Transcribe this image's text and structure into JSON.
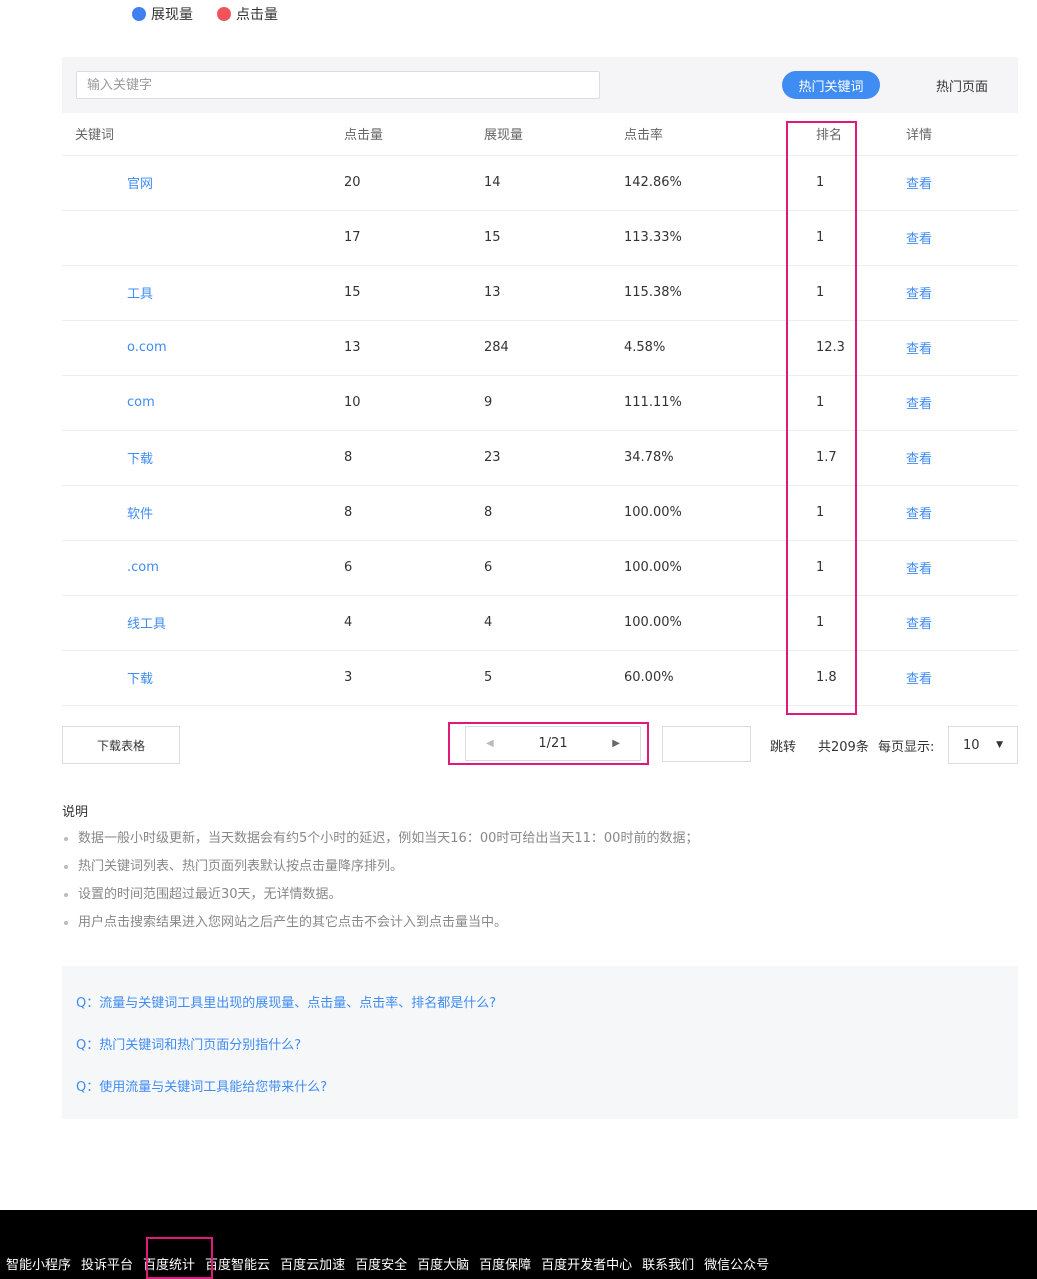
{
  "legend": {
    "items": [
      {
        "label": "展现量",
        "color": "#3f7ff0"
      },
      {
        "label": "点击量",
        "color": "#f0545a"
      }
    ]
  },
  "toolbar": {
    "search_placeholder": "输入关键字",
    "tab_active": "热门关键词",
    "tab_other": "热门页面"
  },
  "table": {
    "headers": [
      "关键词",
      "点击量",
      "展现量",
      "点击率",
      "排名",
      "详情"
    ],
    "rows": [
      {
        "keyword": "官网",
        "clicks": "20",
        "impressions": "14",
        "ctr": "142.86%",
        "rank": "1",
        "detail": "查看"
      },
      {
        "keyword": "",
        "clicks": "17",
        "impressions": "15",
        "ctr": "113.33%",
        "rank": "1",
        "detail": "查看"
      },
      {
        "keyword": "工具",
        "clicks": "15",
        "impressions": "13",
        "ctr": "115.38%",
        "rank": "1",
        "detail": "查看"
      },
      {
        "keyword": "o.com",
        "clicks": "13",
        "impressions": "284",
        "ctr": "4.58%",
        "rank": "12.3",
        "detail": "查看"
      },
      {
        "keyword": "com",
        "clicks": "10",
        "impressions": "9",
        "ctr": "111.11%",
        "rank": "1",
        "detail": "查看"
      },
      {
        "keyword": "下载",
        "clicks": "8",
        "impressions": "23",
        "ctr": "34.78%",
        "rank": "1.7",
        "detail": "查看"
      },
      {
        "keyword": "软件",
        "clicks": "8",
        "impressions": "8",
        "ctr": "100.00%",
        "rank": "1",
        "detail": "查看"
      },
      {
        "keyword": ".com",
        "clicks": "6",
        "impressions": "6",
        "ctr": "100.00%",
        "rank": "1",
        "detail": "查看"
      },
      {
        "keyword": "线工具",
        "clicks": "4",
        "impressions": "4",
        "ctr": "100.00%",
        "rank": "1",
        "detail": "查看"
      },
      {
        "keyword": "下载",
        "clicks": "3",
        "impressions": "5",
        "ctr": "60.00%",
        "rank": "1.8",
        "detail": "查看"
      }
    ]
  },
  "pagination": {
    "download_label": "下载表格",
    "page": "1/21",
    "jump_label": "跳转",
    "total": "共209条",
    "per_page_label": "每页显示:",
    "per_page_value": "10"
  },
  "notes": {
    "title": "说明",
    "items": [
      "数据一般小时级更新，当天数据会有约5个小时的延迟，例如当天16：00时可给出当天11：00时前的数据；",
      "热门关键词列表、热门页面列表默认按点击量降序排列。",
      "设置的时间范围超过最近30天，无详情数据。",
      "用户点击搜索结果进入您网站之后产生的其它点击不会计入到点击量当中。"
    ]
  },
  "faq": [
    "Q：流量与关键词工具里出现的展现量、点击量、点击率、排名都是什么?",
    "Q：热门关键词和热门页面分别指什么?",
    "Q：使用流量与关键词工具能给您带来什么?"
  ],
  "footer": {
    "links": [
      "智能小程序",
      "投诉平台",
      "百度统计",
      "百度智能云",
      "百度云加速",
      "百度安全",
      "百度大脑",
      "百度保障",
      "百度开发者中心",
      "联系我们",
      "微信公众号"
    ]
  }
}
